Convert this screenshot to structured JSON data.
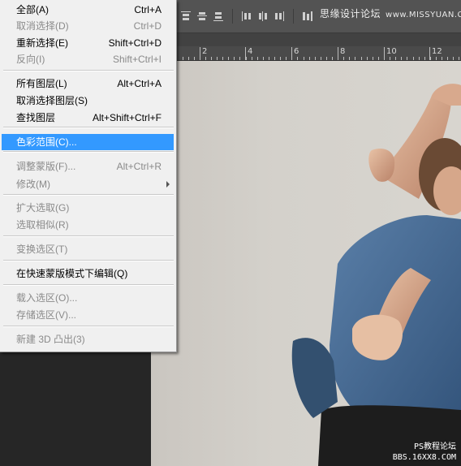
{
  "watermark_top": {
    "text": "思缘设计论坛",
    "site": "www.MISSYUAN.COM"
  },
  "watermark_bottom": {
    "line1": "PS教程论坛",
    "line2": "BBS.16XX8.COM"
  },
  "ruler": {
    "labels": [
      "2",
      "4",
      "6",
      "8",
      "10",
      "12"
    ]
  },
  "menu": {
    "items": [
      {
        "label": "全部(A)",
        "shortcut": "Ctrl+A",
        "enabled": true
      },
      {
        "label": "取消选择(D)",
        "shortcut": "Ctrl+D",
        "enabled": false
      },
      {
        "label": "重新选择(E)",
        "shortcut": "Shift+Ctrl+D",
        "enabled": true
      },
      {
        "label": "反向(I)",
        "shortcut": "Shift+Ctrl+I",
        "enabled": false
      },
      {
        "label": "所有图层(L)",
        "shortcut": "Alt+Ctrl+A",
        "enabled": true
      },
      {
        "label": "取消选择图层(S)",
        "shortcut": "",
        "enabled": true
      },
      {
        "label": "查找图层",
        "shortcut": "Alt+Shift+Ctrl+F",
        "enabled": true
      },
      {
        "label": "色彩范围(C)...",
        "shortcut": "",
        "enabled": true,
        "selected": true
      },
      {
        "label": "调整蒙版(F)...",
        "shortcut": "Alt+Ctrl+R",
        "enabled": false
      },
      {
        "label": "修改(M)",
        "shortcut": "",
        "enabled": false,
        "submenu": true
      },
      {
        "label": "扩大选取(G)",
        "shortcut": "",
        "enabled": false
      },
      {
        "label": "选取相似(R)",
        "shortcut": "",
        "enabled": false
      },
      {
        "label": "变换选区(T)",
        "shortcut": "",
        "enabled": false
      },
      {
        "label": "在快速蒙版模式下编辑(Q)",
        "shortcut": "",
        "enabled": true
      },
      {
        "label": "载入选区(O)...",
        "shortcut": "",
        "enabled": false
      },
      {
        "label": "存储选区(V)...",
        "shortcut": "",
        "enabled": false
      },
      {
        "label": "新建 3D 凸出(3)",
        "shortcut": "",
        "enabled": false
      }
    ]
  },
  "colors": {
    "menu_bg": "#f0f0f0",
    "menu_selected": "#3399ff",
    "menu_disabled_text": "#8a8a8a",
    "toolbar_bg": "#535353",
    "canvas_bg": "#d4d1cb"
  }
}
